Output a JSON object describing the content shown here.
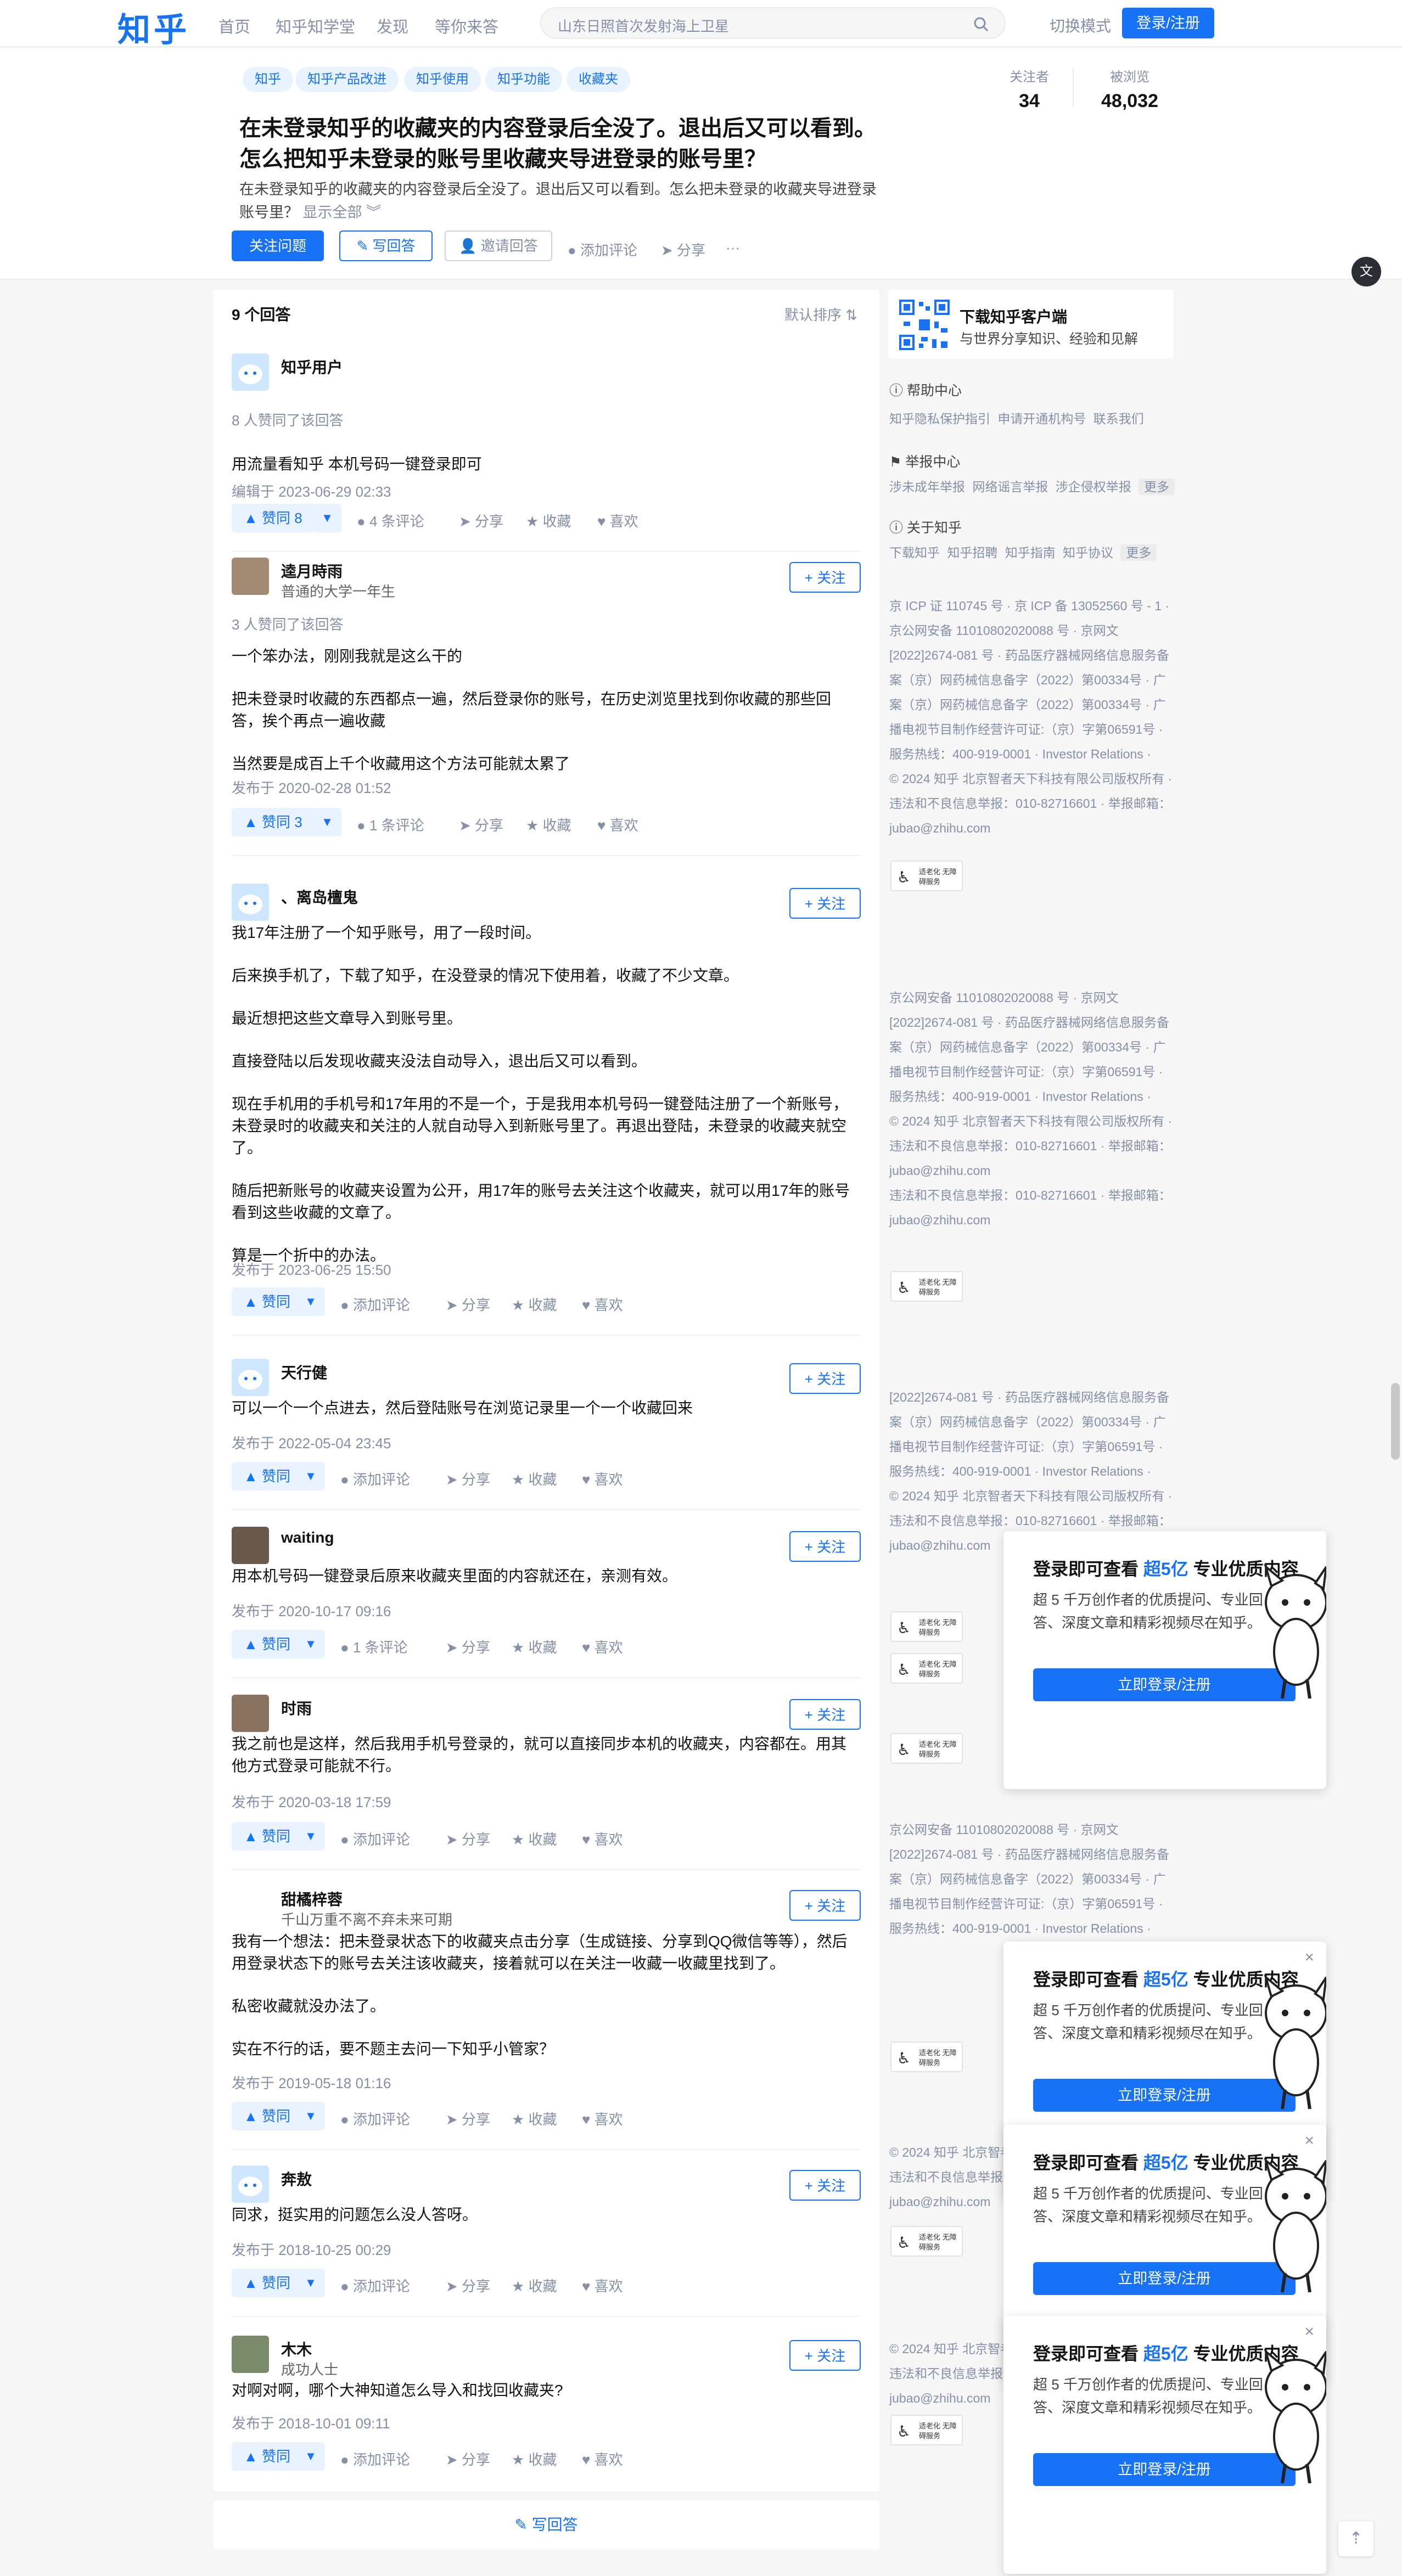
{
  "nav": {
    "logo": "知乎",
    "links": [
      "首页",
      "知乎知学堂",
      "发现",
      "等你来答"
    ],
    "search_placeholder": "山东日照首次发射海上卫星",
    "switch_mode": "切换模式",
    "login": "登录/注册"
  },
  "question": {
    "tags": [
      "知乎",
      "知乎产品改进",
      "知乎使用",
      "知乎功能",
      "收藏夹"
    ],
    "title": "在未登录知乎的收藏夹的内容登录后全没了。退出后又可以看到。怎么把知乎未登录的账号里收藏夹导进登录的账号里？",
    "desc": "在未登录知乎的收藏夹的内容登录后全没了。退出后又可以看到。怎么把未登录的收藏夹导进登录账号里？",
    "show_all": "显示全部 ︾",
    "followers_label": "关注者",
    "followers": "34",
    "views_label": "被浏览",
    "views": "48,032",
    "follow_btn": "关注问题",
    "write_btn": "✎ 写回答",
    "invite_btn": "邀请回答",
    "comment": "添加评论",
    "share": "分享",
    "more": "···"
  },
  "answers_header": {
    "count": "9 个回答",
    "sort": "默认排序"
  },
  "answers": [
    {
      "author": "知乎用户",
      "headline": "",
      "follow": "",
      "voted": "8 人赞同了该回答",
      "paragraphs": [
        "用流量看知乎 本机号码一键登录即可"
      ],
      "date": "编辑于 2023-06-29 02:33",
      "vote": "赞同 8",
      "comments": "4 条评论"
    },
    {
      "author": "逵月時雨",
      "headline": "普通的大学一年生",
      "follow": "+ 关注",
      "voted": "3 人赞同了该回答",
      "paragraphs": [
        "一个笨办法，刚刚我就是这么干的",
        "把未登录时收藏的东西都点一遍，然后登录你的账号，在历史浏览里找到你收藏的那些回答，挨个再点一遍收藏",
        "当然要是成百上千个收藏用这个方法可能就太累了"
      ],
      "date": "发布于 2020-02-28 01:52",
      "vote": "赞同 3",
      "comments": "1 条评论"
    },
    {
      "author": "、离岛檀鬼",
      "headline": "",
      "follow": "+ 关注",
      "voted": "",
      "paragraphs": [
        "我17年注册了一个知乎账号，用了一段时间。",
        "后来换手机了，下载了知乎，在没登录的情况下使用着，收藏了不少文章。",
        "最近想把这些文章导入到账号里。",
        "直接登陆以后发现收藏夹没法自动导入，退出后又可以看到。",
        "现在手机用的手机号和17年用的不是一个，于是我用本机号码一键登陆注册了一个新账号，未登录时的收藏夹和关注的人就自动导入到新账号里了。再退出登陆，未登录的收藏夹就空了。",
        "随后把新账号的收藏夹设置为公开，用17年的账号去关注这个收藏夹，就可以用17年的账号看到这些收藏的文章了。",
        "算是一个折中的办法。"
      ],
      "date": "发布于 2023-06-25 15:50",
      "vote": "赞同",
      "comments": "添加评论"
    },
    {
      "author": "天行健",
      "headline": "",
      "follow": "+ 关注",
      "voted": "",
      "paragraphs": [
        "可以一个一个点进去，然后登陆账号在浏览记录里一个一个收藏回来"
      ],
      "date": "发布于 2022-05-04 23:45",
      "vote": "赞同",
      "comments": "添加评论"
    },
    {
      "author": "waiting",
      "headline": "",
      "follow": "+ 关注",
      "voted": "",
      "paragraphs": [
        "用本机号码一键登录后原来收藏夹里面的内容就还在，亲测有效。"
      ],
      "date": "发布于 2020-10-17 09:16",
      "vote": "赞同",
      "comments": "1 条评论"
    },
    {
      "author": "时雨",
      "headline": "",
      "follow": "+ 关注",
      "voted": "",
      "paragraphs": [
        "我之前也是这样，然后我用手机号登录的，就可以直接同步本机的收藏夹，内容都在。用其他方式登录可能就不行。"
      ],
      "date": "发布于 2020-03-18 17:59",
      "vote": "赞同",
      "comments": "添加评论"
    },
    {
      "author": "甜橘梓蓉",
      "headline": "千山万重不离不弃未来可期",
      "follow": "+ 关注",
      "voted": "",
      "paragraphs": [
        "我有一个想法：把未登录状态下的收藏夹点击分享（生成链接、分享到QQ微信等等），然后用登录状态下的账号去关注该收藏夹，接着就可以在关注一收藏一收藏里找到了。",
        "私密收藏就没办法了。",
        "实在不行的话，要不题主去问一下知乎小管家？"
      ],
      "date": "发布于 2019-05-18 01:16",
      "vote": "赞同",
      "comments": "添加评论"
    },
    {
      "author": "奔敖",
      "headline": "",
      "follow": "+ 关注",
      "voted": "",
      "paragraphs": [
        "同求，挺实用的问题怎么没人答呀。"
      ],
      "date": "发布于 2018-10-25 00:29",
      "vote": "赞同",
      "comments": "添加评论"
    },
    {
      "author": "木木",
      "headline": "成功人士",
      "follow": "+ 关注",
      "voted": "",
      "paragraphs": [
        "对啊对啊，哪个大神知道怎么导入和找回收藏夹?"
      ],
      "date": "发布于 2018-10-01 09:11",
      "vote": "赞同",
      "comments": "添加评论"
    }
  ],
  "answer_actions": {
    "share": "分享",
    "collect": "收藏",
    "like": "喜欢"
  },
  "write_bottom": "✎ 写回答",
  "sidebar": {
    "app_title": "下载知乎客户端",
    "app_sub": "与世界分享知识、经验和见解",
    "help_title": "帮助中心",
    "help_links": [
      "知乎隐私保护指引",
      "申请开通机构号",
      "联系我们"
    ],
    "report_title": "举报中心",
    "report_links": [
      "涉未成年举报",
      "网络谣言举报",
      "涉企侵权举报"
    ],
    "about_title": "关于知乎",
    "about_links": [
      "下载知乎",
      "知乎招聘",
      "知乎指南",
      "知乎协议"
    ],
    "more": "更多",
    "footer_lines": [
      "京 ICP 证 110745 号 · 京 ICP 备 13052560 号 - 1 ·",
      "京公网安备 11010802020088 号 · 京网文",
      "[2022]2674-081 号 · 药品医疗器械网络信息服务备",
      "案（京）网药械信息备字（2022）第00334号 · 广",
      "案（京）网药械信息备字（2022）第00334号 · 广",
      "播电视节目制作经营许可证:（京）字第06591号 ·",
      "服务热线：400-919-0001 · Investor Relations ·",
      "© 2024 知乎 北京智者天下科技有限公司版权所有 ·",
      "违法和不良信息举报：010-82716601 · 举报邮箱：",
      "jubao@zhihu.com"
    ],
    "ghost_lines": [
      "京公网安备 11010802020088 号 · 京网文",
      "[2022]2674-081 号 · 药品医疗器械网络信息服务备",
      "案（京）网药械信息备字（2022）第00334号 · 广",
      "播电视节目制作经营许可证:（京）字第06591号 ·",
      "服务热线：400-919-0001 · Investor Relations ·",
      "© 2024 知乎 北京智者天下科技有限公司版权所有 ·",
      "违法和不良信息举报：010-82716601 · 举报邮箱：",
      "jubao@zhihu.com",
      "违法和不良信息举报：010-82716601 · 举报邮箱：",
      "jubao@zhihu.com"
    ],
    "badge_text": "适老化 无障碍服务"
  },
  "popup": {
    "title_a": "登录即可查看 ",
    "title_hl": "超5亿",
    "title_b": " 专业优质内容",
    "desc": "超 5 千万创作者的优质提问、专业回答、深度文章和精彩视频尽在知乎。",
    "button": "立即登录/注册",
    "close": "×"
  },
  "colors": {
    "brand": "#1772f6",
    "muted": "#8590a6",
    "tag_bg": "#e8f3ff"
  }
}
